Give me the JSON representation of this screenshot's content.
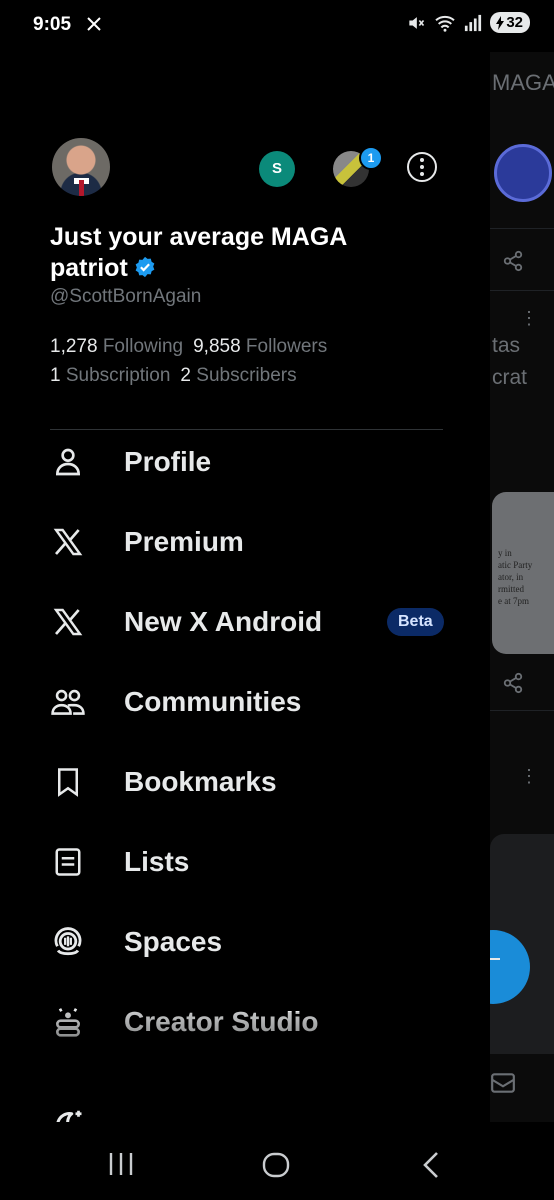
{
  "status_bar": {
    "time": "9:05",
    "battery": "32"
  },
  "profile": {
    "display_name": "Just your average MAGA patriot",
    "handle": "@ScottBornAgain",
    "following_count": "1,278",
    "following_label": "Following",
    "followers_count": "9,858",
    "followers_label": "Followers",
    "subscription_count": "1",
    "subscription_label": "Subscription",
    "subscribers_count": "2",
    "subscribers_label": "Subscribers"
  },
  "accounts": {
    "secondary_initial": "S",
    "notification_count": "1"
  },
  "menu": {
    "items": [
      {
        "label": "Profile",
        "icon": "person-icon"
      },
      {
        "label": "Premium",
        "icon": "x-logo-icon"
      },
      {
        "label": "New X Android",
        "icon": "x-logo-icon",
        "badge": "Beta"
      },
      {
        "label": "Communities",
        "icon": "communities-icon"
      },
      {
        "label": "Bookmarks",
        "icon": "bookmark-icon"
      },
      {
        "label": "Lists",
        "icon": "list-icon"
      },
      {
        "label": "Spaces",
        "icon": "spaces-icon"
      },
      {
        "label": "Creator Studio",
        "icon": "creator-studio-icon"
      }
    ]
  },
  "background_feed": {
    "tab_fragment": "MAGA",
    "text_line_1": "tas",
    "text_line_2": "crat",
    "card_lines": [
      "y in",
      "atic Party",
      "ator, in",
      "rmitted",
      "e at 7pm"
    ]
  },
  "colors": {
    "background": "#000000",
    "text_primary": "#e7e9ea",
    "text_secondary": "#71767b",
    "accent": "#1d9bf0",
    "beta_badge_bg": "#0b2a66"
  }
}
